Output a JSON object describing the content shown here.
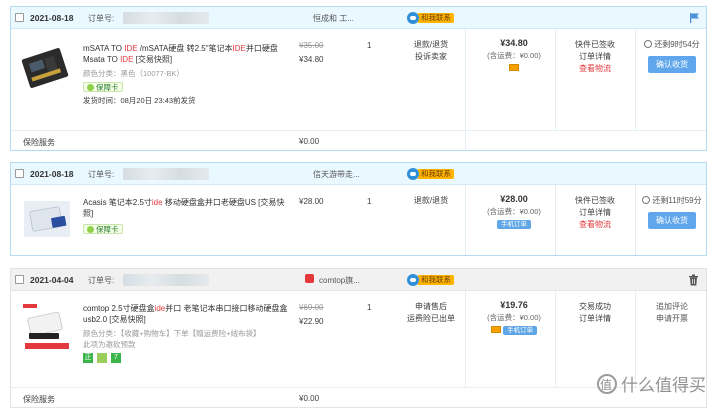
{
  "orders": [
    {
      "date": "2021-08-18",
      "order_label": "订单号:",
      "shop": "恒成和 工...",
      "contact_label": "和我联系",
      "product_title_parts": [
        "mSATA TO ",
        "IDE",
        " /mSATA硬盘 转2.5\"笔记本",
        "IDE",
        "并口硬盘 Msata TO ",
        "IDE",
        " [交易快照]"
      ],
      "color_spec": "颜色分类：黑色（10077-BK）",
      "badge": "保障卡",
      "ship_note": "发货时间：08月20日 23:43前发货",
      "old_price": "¥35.00",
      "price": "¥34.80",
      "qty": "1",
      "ops": [
        "退款/退货",
        "投诉卖家"
      ],
      "total": "¥34.80",
      "shipping": "(含运费：¥0.00)",
      "status": [
        "快件已签收",
        "订单详情",
        "查看物流"
      ],
      "timer": "还剩9时54分",
      "action_button": "确认收货",
      "insurance_label": "保险服务",
      "insurance_price": "¥0.00"
    },
    {
      "date": "2021-08-18",
      "order_label": "订单号:",
      "shop": "信天游带走...",
      "contact_label": "和我联系",
      "product_title_parts": [
        "Acasis 笔记本2.5寸",
        "ide",
        " 移动硬盘盒并口老硬盘US [交易快照]"
      ],
      "badge": "保障卡",
      "price": "¥28.00",
      "qty": "1",
      "ops": [
        "退款/退货"
      ],
      "total": "¥28.00",
      "shipping": "(含运费：¥0.00)",
      "mobile_label": "手机订单",
      "status": [
        "快件已签收",
        "订单详情",
        "查看物流"
      ],
      "timer": "还剩11时59分",
      "action_button": "确认收货"
    },
    {
      "date": "2021-04-04",
      "order_label": "订单号:",
      "shop": "comtop旗...",
      "contact_label": "和我联系",
      "product_title_parts": [
        "comtop 2.5寸硬盘盒",
        "ide",
        "并口 老笔记本串口接口移动硬盘盒usb2.0 [交易快照]"
      ],
      "color_spec": "颜色分类：【收藏+购物车】下单【赠运费险+绒布袋】",
      "extra_note": "此项为邀砍预款",
      "old_price": "¥69.00",
      "price": "¥22.90",
      "qty": "1",
      "ops": [
        "申请售后",
        "运费险已出单"
      ],
      "total": "¥19.76",
      "shipping": "(含运费：¥0.00)",
      "mobile_label": "手机订单",
      "status": [
        "交易成功",
        "订单详情"
      ],
      "actions": [
        "追加评论",
        "申请开票"
      ],
      "insurance_label": "保险服务",
      "insurance_price": "¥0.00"
    }
  ],
  "watermark": "什么值得买"
}
